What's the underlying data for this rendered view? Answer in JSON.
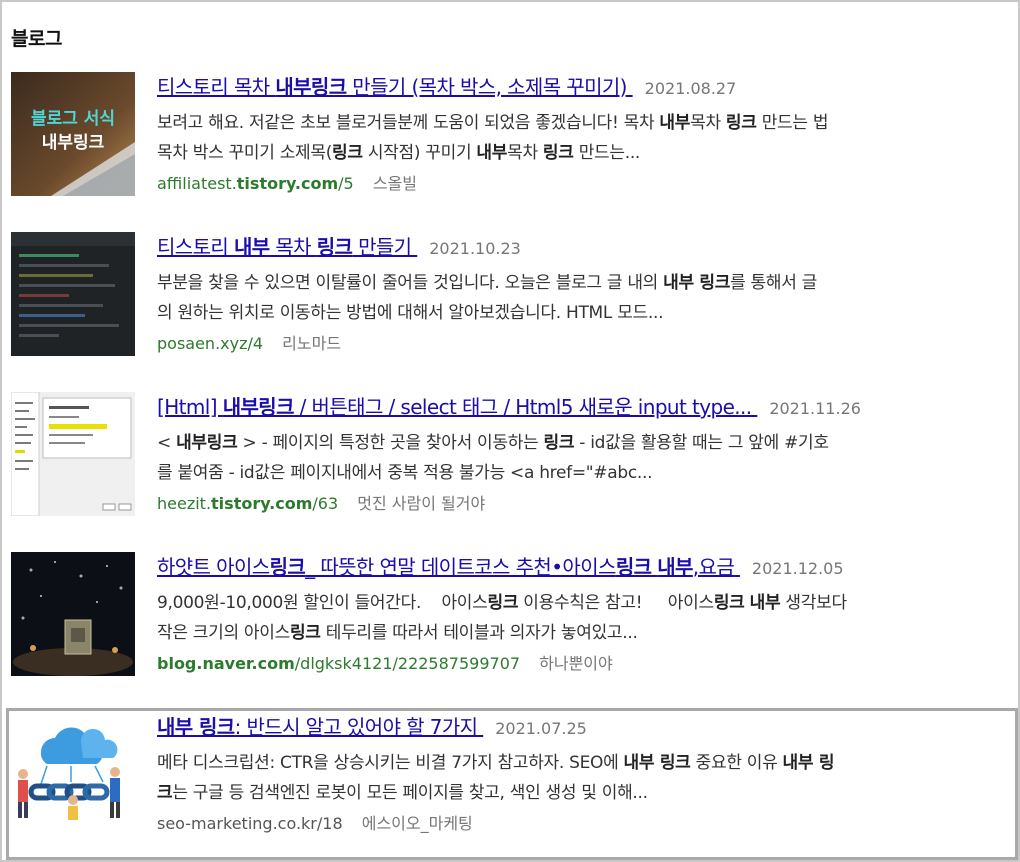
{
  "section": {
    "title": "블로그"
  },
  "results": [
    {
      "title_parts": [
        "티스토리 목차 ",
        "내부링크",
        " 만들기 (목차 박스, 소제목 꾸미기)"
      ],
      "date": "2021.08.27",
      "snippet_line1": [
        "보려고 해요. 저같은 초보 블로거들분께 도움이 되었음 좋겠습니다! 목차 ",
        "내부",
        "목차 ",
        "링크",
        " 만드는 법"
      ],
      "snippet_line2": [
        "목차 박스 꾸미기 소제목(",
        "링크",
        " 시작점) 꾸미기 ",
        "내부",
        "목차 ",
        "링크",
        " 만드는..."
      ],
      "url_parts": [
        "affiliatest.",
        "tistory.com",
        "/5"
      ],
      "author": "스올빌",
      "thumb_text1": "블로그 서식",
      "thumb_text2": "내부링크"
    },
    {
      "title_parts": [
        "티스토리 ",
        "내부",
        " 목차 ",
        "링크",
        " 만들기"
      ],
      "date": "2021.10.23",
      "snippet_line1": [
        "부분을 찾을 수 있으면 이탈률이 줄어들 것입니다. 오늘은 블로그 글 내의 ",
        "내부 링크",
        "를 통해서 글"
      ],
      "snippet_line2": [
        "의 원하는 위치로 이동하는 방법에 대해서 알아보겠습니다. HTML 모드..."
      ],
      "url_parts": [
        "posaen.xyz/4"
      ],
      "author": "리노마드"
    },
    {
      "title_parts": [
        "[Html] ",
        "내부링크",
        " / 버튼태그 / select 태그 / Html5 새로운 input type..."
      ],
      "date": "2021.11.26",
      "snippet_line1": [
        "< ",
        "내부링크",
        " > - 페이지의 특정한 곳을 찾아서 이동하는 ",
        "링크",
        " - id값을 활용할 때는 그 앞에 #기호"
      ],
      "snippet_line2": [
        "를 붙여줌 - id값은 페이지내에서 중복 적용 불가능 <a href=\"#abc..."
      ],
      "url_parts": [
        "heezit.",
        "tistory.com",
        "/63"
      ],
      "author": "멋진 사람이 될거야"
    },
    {
      "title_parts": [
        "하얏트 아이스",
        "링크",
        "_ 따뜻한 연말 데이트코스 추천•아이스",
        "링크",
        " ",
        "내부",
        ",요금"
      ],
      "date": "2021.12.05",
      "snippet_line1": [
        "9,000원-10,000원 할인이 들어간다.    아이스",
        "링크",
        " 이용수칙은 참고!     아이스",
        "링크",
        " ",
        "내부",
        " 생각보다"
      ],
      "snippet_line2": [
        "작은 크기의 아이스",
        "링크",
        " 테두리를 따라서 테이블과 의자가 놓여있고..."
      ],
      "url_parts": [
        "blog.naver.com",
        "/dlgksk4121/222587599707"
      ],
      "author": "하나뿐이야"
    },
    {
      "title_parts": [
        "내부 링크",
        ": 반드시 알고 있어야 할 7가지"
      ],
      "date": "2021.07.25",
      "snippet_line1": [
        "메타 디스크립션: CTR을 상승시키는 비결 7가지 참고하자. SEO에 ",
        "내부 링크",
        " 중요한 이유 ",
        "내부 링"
      ],
      "snippet_line2": [
        "크",
        "는 구글 등 검색엔진 로봇이 모든 페이지를 찾고, 색인 생성 및 이해..."
      ],
      "url_parts": [
        "seo-marketing.co.kr/18"
      ],
      "author": "에스이오_마케팅"
    }
  ],
  "colors": {
    "link": "#1a0dab",
    "url": "#2c7a2c",
    "meta": "#767676"
  }
}
